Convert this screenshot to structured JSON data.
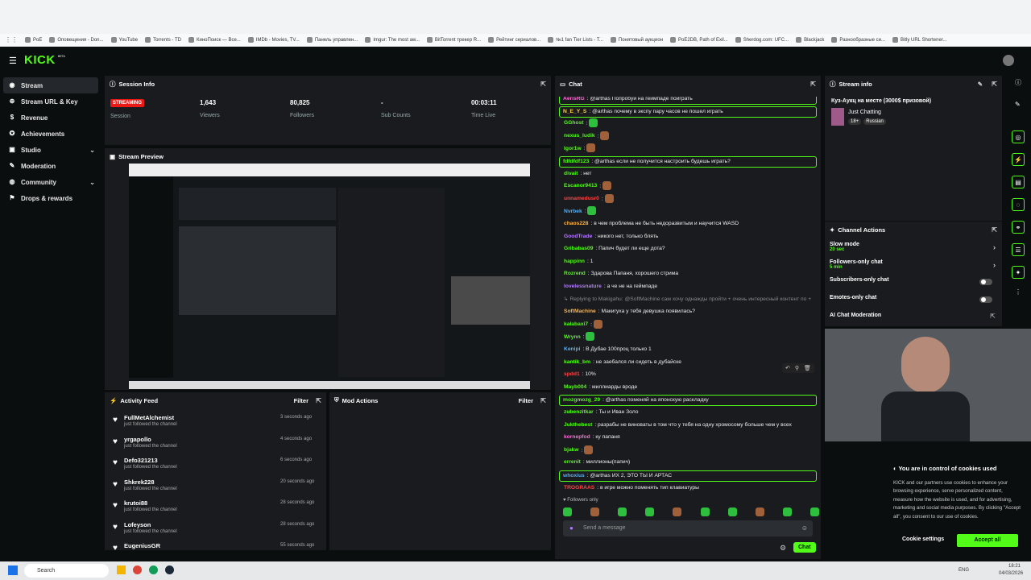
{
  "bookmarks": [
    "PoE",
    "Оповещения - Don...",
    "YouTube",
    "Torrents - TD",
    "КиноПоиск — Все...",
    "IMDb - Movies, TV...",
    "Панель управлен...",
    "Imgur: The most aw...",
    "BitTorrent трекер R...",
    "Рейтинг сериалов...",
    "№1 fan Tier Lists - T...",
    "Понятовый аукцион",
    "PoE2DB, Path of Exil...",
    "Sherdog.com: UFC...",
    "Blackjack",
    "Разнообразные си...",
    "Bitly URL Shortener..."
  ],
  "logo": "KICK",
  "logo_sup": "BETA",
  "sidebar": {
    "items": [
      {
        "label": "Stream",
        "icon": "stream-icon"
      },
      {
        "label": "Stream URL & Key",
        "icon": "key-icon"
      },
      {
        "label": "Revenue",
        "icon": "dollar-icon"
      },
      {
        "label": "Achievements",
        "icon": "trophy-icon"
      },
      {
        "label": "Studio",
        "icon": "studio-icon",
        "chevron": true
      },
      {
        "label": "Moderation",
        "icon": "wrench-icon"
      },
      {
        "label": "Community",
        "icon": "globe-icon",
        "chevron": true
      },
      {
        "label": "Drops & rewards",
        "icon": "gift-icon"
      }
    ]
  },
  "session": {
    "title": "Session Info",
    "badge": "STREAMING",
    "session_label": "Session",
    "stats": [
      {
        "value": "1,643",
        "label": "Viewers"
      },
      {
        "value": "80,825",
        "label": "Followers"
      },
      {
        "value": "-",
        "label": "Sub Counts"
      },
      {
        "value": "00:03:11",
        "label": "Time Live"
      }
    ]
  },
  "preview": {
    "title": "Stream Preview"
  },
  "activity": {
    "title": "Activity Feed",
    "filter": "Filter",
    "items": [
      {
        "name": "FullMetAlchemist",
        "sub": "just followed the channel",
        "time": "3 seconds ago"
      },
      {
        "name": "yrgapollo",
        "sub": "just followed the channel",
        "time": "4 seconds ago"
      },
      {
        "name": "Defo321213",
        "sub": "just followed the channel",
        "time": "6 seconds ago"
      },
      {
        "name": "Shkrek228",
        "sub": "just followed the channel",
        "time": "20 seconds ago"
      },
      {
        "name": "krutoi88",
        "sub": "just followed the channel",
        "time": "28 seconds ago"
      },
      {
        "name": "Lofeyson",
        "sub": "just followed the channel",
        "time": "28 seconds ago"
      },
      {
        "name": "EugeniusGR",
        "sub": "",
        "time": "55 seconds ago"
      }
    ]
  },
  "mod": {
    "title": "Mod Actions",
    "filter": "Filter"
  },
  "chat": {
    "title": "Chat",
    "followers_only": "Followers only",
    "placeholder": "Send a message",
    "send": "Chat",
    "messages": [
      {
        "user": "AerisRG",
        "color": "#ff6bd6",
        "text": "@arthas Попробуй на геймпаде поиграть",
        "hl": true
      },
      {
        "user": "N_E_Y_S",
        "color": "#ffd23f",
        "text": "@arthas почему в экспу пару часов не пошел играть",
        "hl": true
      },
      {
        "user": "GGhost",
        "color": "#53fc18",
        "text": "",
        "emote": "g"
      },
      {
        "user": "nexus_ludik",
        "color": "#53fc18",
        "text": "",
        "emote": "p"
      },
      {
        "user": "Igor1w",
        "color": "#53fc18",
        "text": "",
        "emote": "p"
      },
      {
        "user": "fdfdfdf123",
        "color": "#53fc18",
        "text": "@arthas если не получится настроить будешь играть?",
        "hl": true
      },
      {
        "user": "divait",
        "color": "#53fc18",
        "text": "нет"
      },
      {
        "user": "Escanor9413",
        "color": "#53fc18",
        "text": "",
        "emote": "p"
      },
      {
        "user": "unnamedusr0",
        "color": "#ff4444",
        "text": "",
        "emote": "p"
      },
      {
        "user": "Nvrbek",
        "color": "#4fb3ff",
        "text": "",
        "emote": "g"
      },
      {
        "user": "chaos228",
        "color": "#ffb347",
        "text": "в чем проблема не быть недоразвитым и научится WASD"
      },
      {
        "user": "GoodTrade",
        "color": "#b57aff",
        "text": "никого нет, только блять"
      },
      {
        "user": "Gribabas09",
        "color": "#53fc18",
        "text": "Папич будет ли еще дота?"
      },
      {
        "user": "happinn",
        "color": "#53fc18",
        "text": "1"
      },
      {
        "user": "Rozrend",
        "color": "#53fc18",
        "text": "Здарова Папаня, хорошего стрима"
      },
      {
        "user": "lovelessnature",
        "color": "#b57aff",
        "text": "а че не на геймпаде"
      },
      {
        "user": "",
        "color": "#888",
        "text": "↳ Replying to Makigahu: @SoftMachine сам хочу однажды пройти + очень интересный контент по +"
      },
      {
        "user": "SoftMachine",
        "color": "#ffb347",
        "text": "Макигуха у тебя девушка появилась?"
      },
      {
        "user": "kalabaxi7",
        "color": "#53fc18",
        "text": "",
        "emote": "p"
      },
      {
        "user": "Wrynn",
        "color": "#53fc18",
        "text": "",
        "emote": "g"
      },
      {
        "user": "Kenipi",
        "color": "#4fb3ff",
        "text": "В Дубае 100проц только 1"
      },
      {
        "user": "kantik_bm",
        "color": "#53fc18",
        "text": "не заебался ли сидеть в дубайске"
      },
      {
        "user": "spdd1",
        "color": "#ff4444",
        "text": "10%"
      },
      {
        "user": "Mayb004",
        "color": "#53fc18",
        "text": "миллиарды вроде"
      },
      {
        "user": "mozgmozg_29",
        "color": "#53fc18",
        "text": "@arthas поменяй на японскую раскладку",
        "hl": true
      },
      {
        "user": "zubenzitkar",
        "color": "#53fc18",
        "text": "Ты и Иван Золо"
      },
      {
        "user": "Jukthebest",
        "color": "#53fc18",
        "text": "разрабы не виноваты в том что у тебя на одну хромосому больше чем у всех"
      },
      {
        "user": "kornepfod",
        "color": "#ff6bd6",
        "text": "ку папаня"
      },
      {
        "user": "bjakw",
        "color": "#53fc18",
        "text": "",
        "emote": "p"
      },
      {
        "user": "errenit",
        "color": "#53fc18",
        "text": "миллионы(папич)"
      },
      {
        "user": "whoxius",
        "color": "#4fb3ff",
        "text": "@arthas ИХ 2, ЭТО ТЫ И АРТАС",
        "hl": true
      },
      {
        "user": "TROGRAAS",
        "color": "#ff4444",
        "text": "в игре можно поменять тип клавиатуры"
      }
    ]
  },
  "streaminfo": {
    "title": "Stream info",
    "stream_title": "Куз-Аукц на месте (3000$ призовой)",
    "category": "Just Chatting",
    "tags": [
      "18+",
      "Russian"
    ]
  },
  "actions": {
    "title": "Channel Actions",
    "rows": [
      {
        "label": "Slow mode",
        "sub": "20 sec",
        "arrow": true
      },
      {
        "label": "Followers-only chat",
        "sub": "5 min",
        "arrow": true
      },
      {
        "label": "Subscribers-only chat",
        "sub": "",
        "toggle": true
      },
      {
        "label": "Emotes-only chat",
        "sub": "",
        "toggle": true
      },
      {
        "label": "AI Chat Moderation",
        "sub": ""
      }
    ]
  },
  "cookies": {
    "title": "You are in control of cookies used",
    "body": "KICK and our partners use cookies to enhance your browsing experience, serve personalized content, measure how the website is used, and for advertising, marketing and social media purposes. By clicking \"Accept all\", you consent to our use of cookies.",
    "settings": "Cookie settings",
    "accept": "Accept all"
  },
  "taskbar": {
    "search": "Search",
    "lang": "ENG",
    "time": "18:21",
    "date": "04/03/2026"
  },
  "colors": {
    "accent": "#53fc18",
    "panel": "#191b1f",
    "bg": "#0b0e0f",
    "live": "#e91916"
  }
}
